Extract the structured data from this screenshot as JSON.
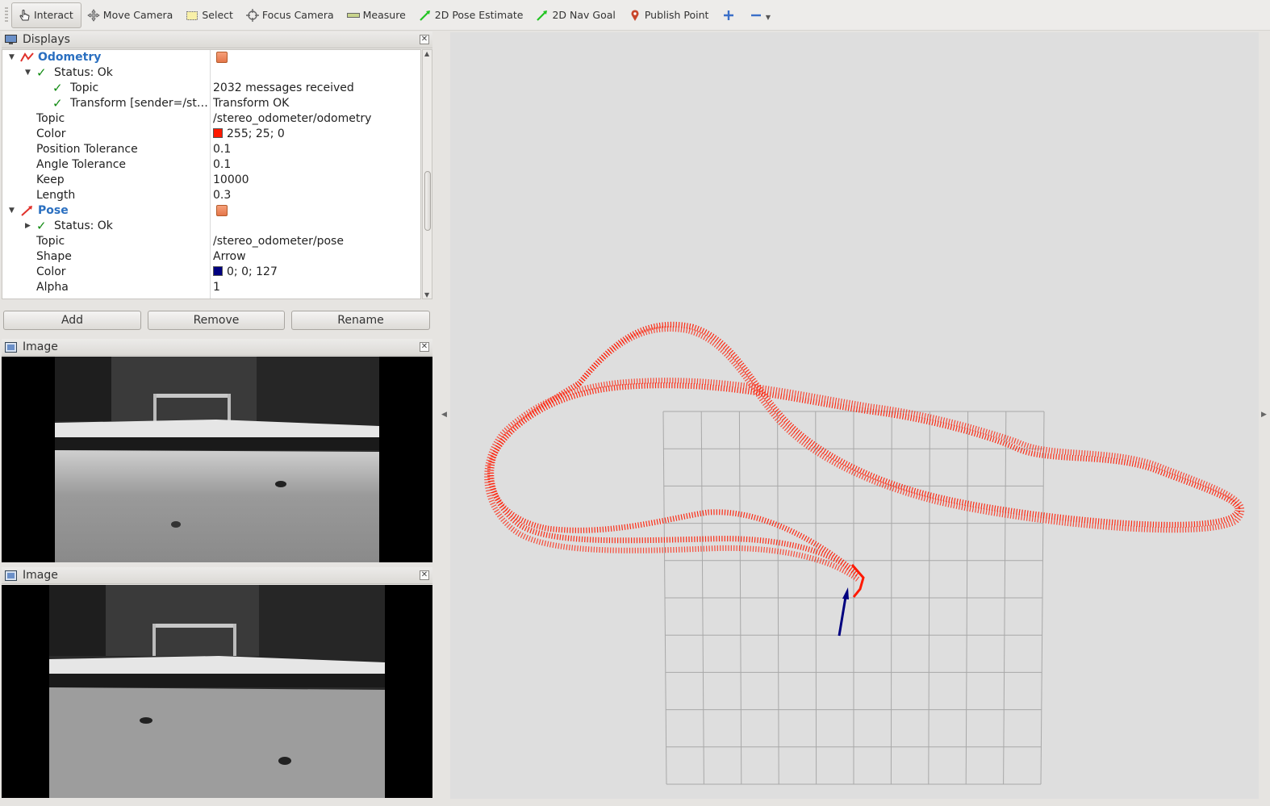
{
  "toolbar": {
    "tools": [
      {
        "label": "Interact",
        "icon": "hand-icon"
      },
      {
        "label": "Move Camera",
        "icon": "move-camera-icon"
      },
      {
        "label": "Select",
        "icon": "select-icon"
      },
      {
        "label": "Focus Camera",
        "icon": "focus-camera-icon"
      },
      {
        "label": "Measure",
        "icon": "ruler-icon"
      },
      {
        "label": "2D Pose Estimate",
        "icon": "green-arrow-icon"
      },
      {
        "label": "2D Nav Goal",
        "icon": "green-arrow-icon"
      },
      {
        "label": "Publish Point",
        "icon": "map-pin-icon"
      }
    ]
  },
  "displays": {
    "title": "Displays",
    "odometry": {
      "name": "Odometry",
      "status": "Status: Ok",
      "topic_status_label": "Topic",
      "topic_status_value": "2032 messages received",
      "transform_label": "Transform [sender=/st…",
      "transform_value": "Transform OK",
      "props": [
        {
          "label": "Topic",
          "value": "/stereo_odometer/odometry"
        },
        {
          "label": "Color",
          "value": "255; 25; 0",
          "swatch": "#ff1900"
        },
        {
          "label": "Position Tolerance",
          "value": "0.1"
        },
        {
          "label": "Angle Tolerance",
          "value": "0.1"
        },
        {
          "label": "Keep",
          "value": "10000"
        },
        {
          "label": "Length",
          "value": "0.3"
        }
      ]
    },
    "pose": {
      "name": "Pose",
      "status": "Status: Ok",
      "props": [
        {
          "label": "Topic",
          "value": "/stereo_odometer/pose"
        },
        {
          "label": "Shape",
          "value": "Arrow"
        },
        {
          "label": "Color",
          "value": "0; 0; 127",
          "swatch": "#00007f"
        },
        {
          "label": "Alpha",
          "value": "1"
        }
      ]
    },
    "buttons": {
      "add": "Add",
      "remove": "Remove",
      "rename": "Rename"
    }
  },
  "image_panels": [
    {
      "title": "Image"
    },
    {
      "title": "Image"
    }
  ],
  "colors": {
    "trajectory": "#ff1900",
    "pose_arrow": "#00007f",
    "grid": "#a8a8a8",
    "render_bg": "#dedede"
  }
}
